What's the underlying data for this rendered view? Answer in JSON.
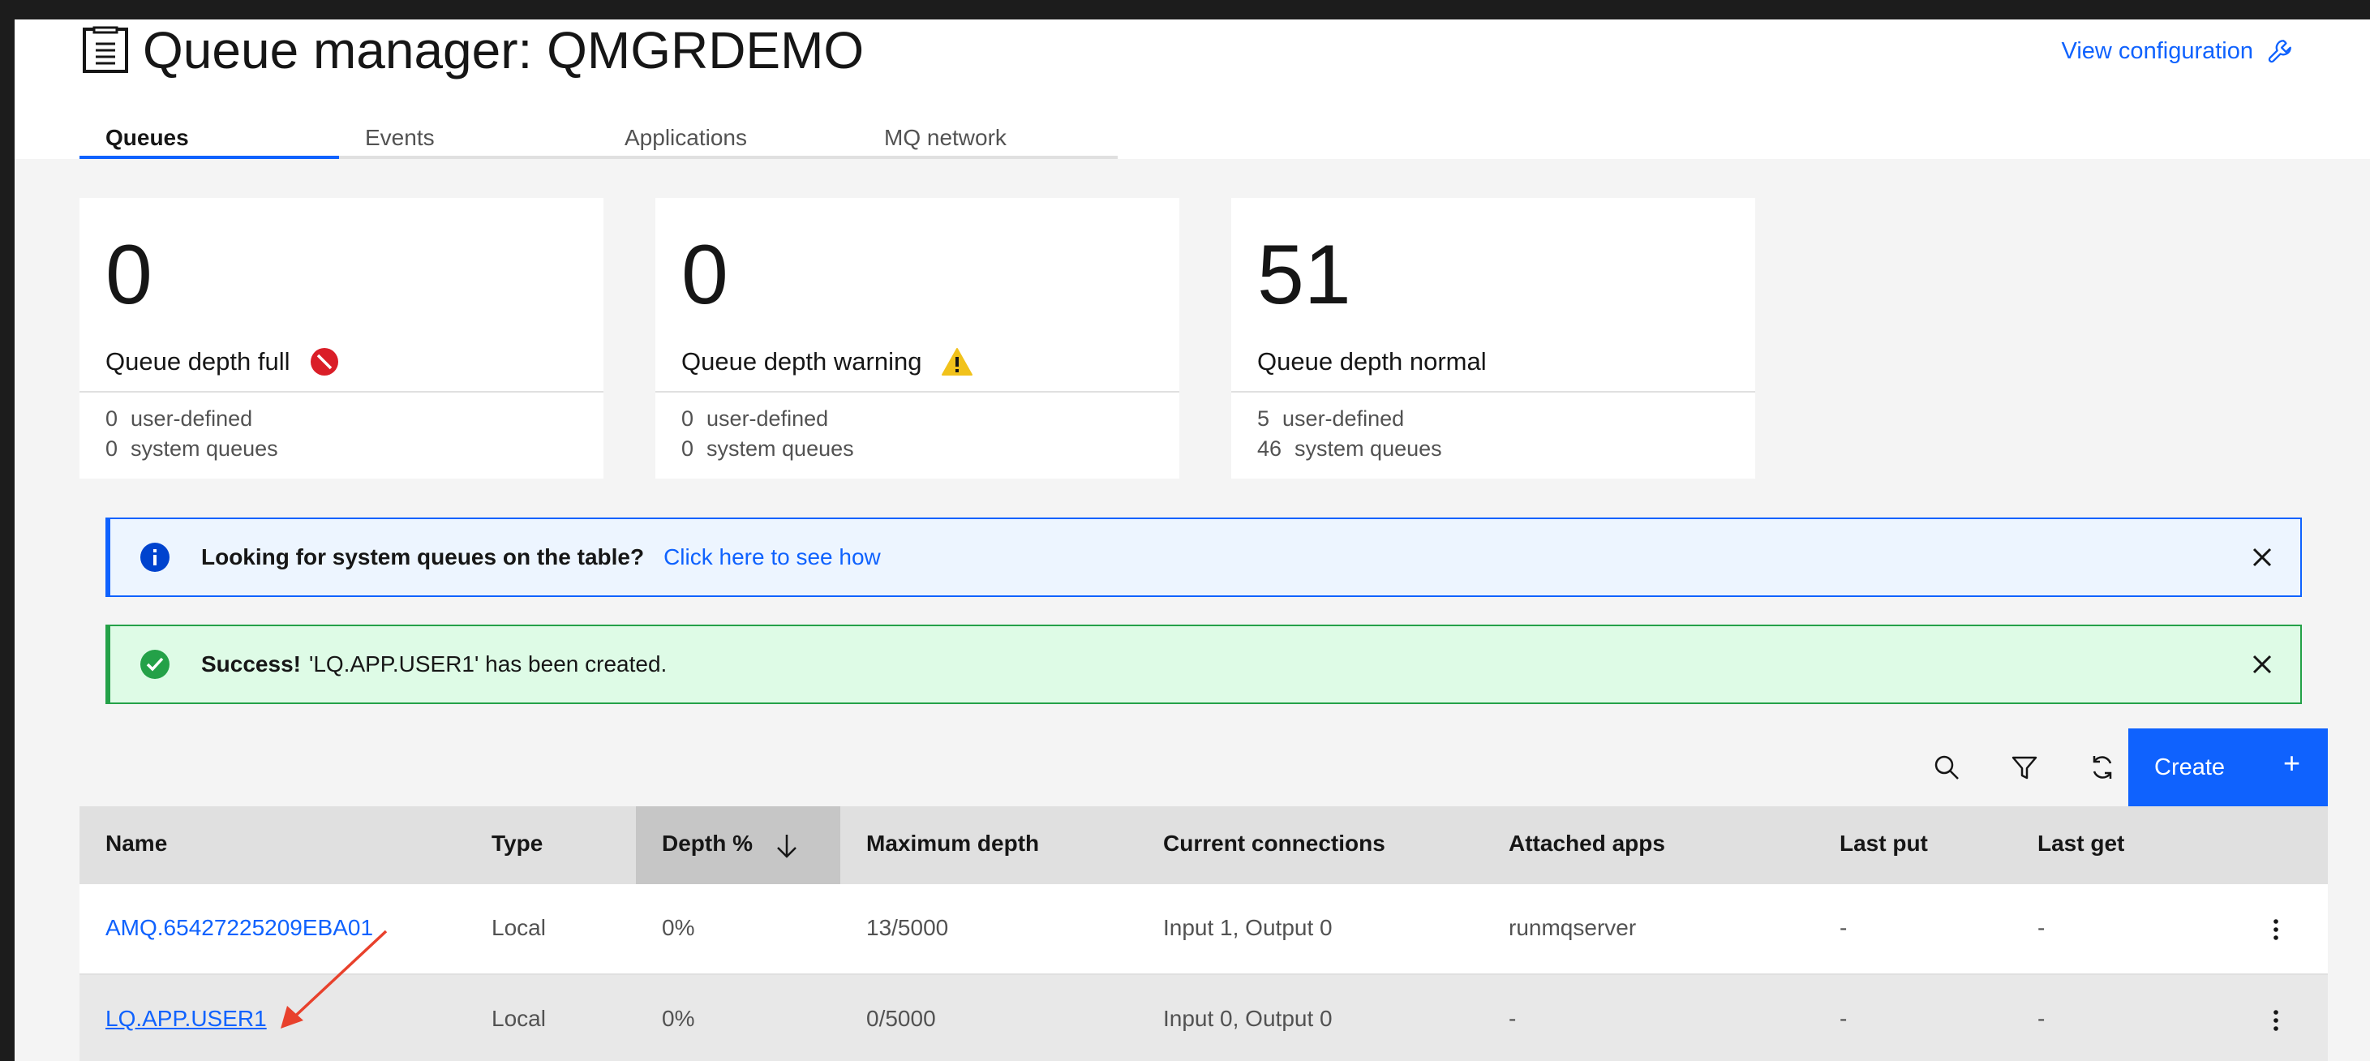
{
  "header": {
    "icon": "queue-manager-icon",
    "title": "Queue manager: QMGRDEMO",
    "view_config": "View configuration",
    "view_config_icon": "wrench-icon"
  },
  "tabs": [
    {
      "label": "Queues",
      "active": true
    },
    {
      "label": "Events",
      "active": false
    },
    {
      "label": "Applications",
      "active": false
    },
    {
      "label": "MQ network",
      "active": false
    }
  ],
  "tiles": [
    {
      "value": "0",
      "label": "Queue depth full",
      "status_icon": "error-icon",
      "user_count": "0",
      "user_label": "user-defined",
      "system_count": "0",
      "system_label": "system queues"
    },
    {
      "value": "0",
      "label": "Queue depth warning",
      "status_icon": "warning-icon",
      "user_count": "0",
      "user_label": "user-defined",
      "system_count": "0",
      "system_label": "system queues"
    },
    {
      "value": "51",
      "label": "Queue depth normal",
      "status_icon": "",
      "user_count": "5",
      "user_label": "user-defined",
      "system_count": "46",
      "system_label": "system queues"
    }
  ],
  "notifications": {
    "info": {
      "title": "Looking for system queues on the table?",
      "link": "Click here to see how"
    },
    "success": {
      "title": "Success!",
      "message": "'LQ.APP.USER1' has been created."
    }
  },
  "toolbar": {
    "search_icon": "search-icon",
    "filter_icon": "filter-icon",
    "refresh_icon": "refresh-icon",
    "create_label": "Create",
    "create_plus": "+"
  },
  "table": {
    "headers": [
      "Name",
      "Type",
      "Depth %",
      "Maximum depth",
      "Current connections",
      "Attached apps",
      "Last put",
      "Last get"
    ],
    "sorted_column": "Depth %",
    "rows": [
      {
        "name": "AMQ.65427225209EBA01",
        "type": "Local",
        "depth": "0%",
        "max_depth": "13/5000",
        "connections": "Input 1, Output 0",
        "apps": "runmqserver",
        "last_put": "-",
        "last_get": "-"
      },
      {
        "name": "LQ.APP.USER1",
        "type": "Local",
        "depth": "0%",
        "max_depth": "0/5000",
        "connections": "Input 0, Output 0",
        "apps": "-",
        "last_put": "-",
        "last_get": "-"
      }
    ]
  },
  "colors": {
    "accent": "#0f62fe",
    "success": "#24a148",
    "error": "#da1e28",
    "warning": "#f1c21b",
    "annotation_arrow": "#e8412c"
  }
}
